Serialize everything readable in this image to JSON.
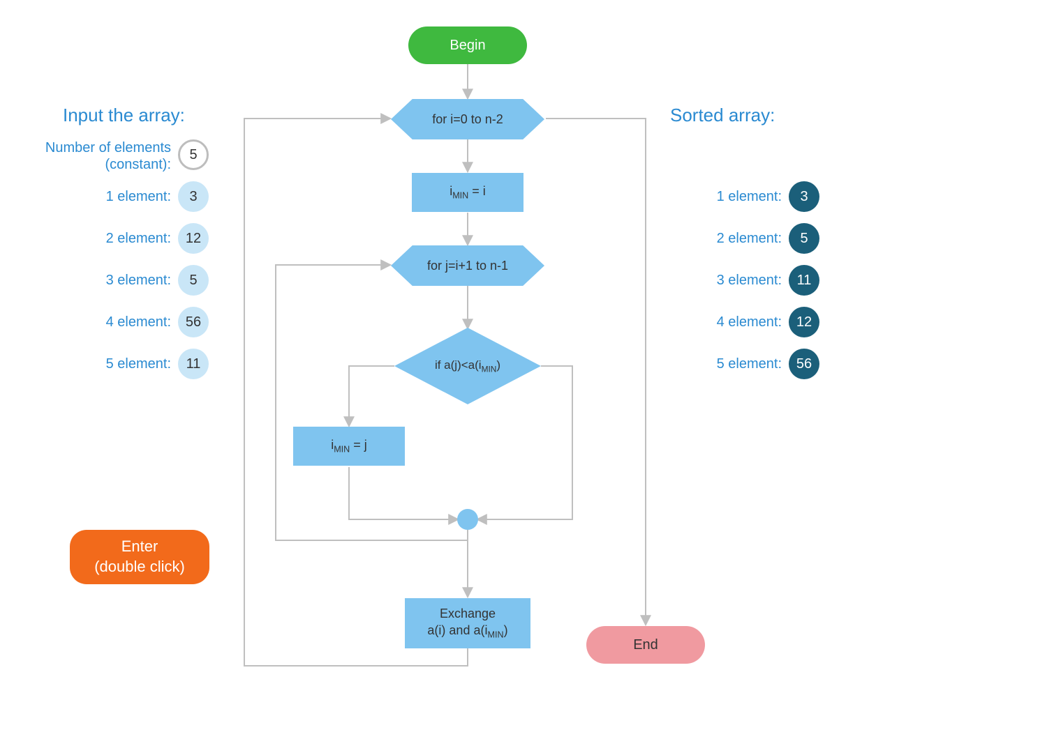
{
  "headings": {
    "input": "Input the array:",
    "sorted": "Sorted array:"
  },
  "input": {
    "count_label": "Number of elements\n(constant):",
    "count_value": "5",
    "items": [
      {
        "label": "1 element:",
        "value": "3"
      },
      {
        "label": "2 element:",
        "value": "12"
      },
      {
        "label": "3 element:",
        "value": "5"
      },
      {
        "label": "4 element:",
        "value": "56"
      },
      {
        "label": "5 element:",
        "value": "11"
      }
    ]
  },
  "sorted": {
    "items": [
      {
        "label": "1 element:",
        "value": "3"
      },
      {
        "label": "2 element:",
        "value": "5"
      },
      {
        "label": "3 element:",
        "value": "11"
      },
      {
        "label": "4 element:",
        "value": "12"
      },
      {
        "label": "5 element:",
        "value": "56"
      }
    ]
  },
  "enter": {
    "line1": "Enter",
    "line2": "(double click)"
  },
  "flow": {
    "begin": "Begin",
    "loop_i": "for i=0 to n-2",
    "set_min_i_pre": "i",
    "set_min_i_sub": "MIN",
    "set_min_i_post": " = i",
    "loop_j": "for j=i+1 to n-1",
    "cond_pre": "if a(j)<a(i",
    "cond_sub": "MIN",
    "cond_post": ")",
    "set_min_j_pre": "i",
    "set_min_j_sub": "MIN",
    "set_min_j_post": " = j",
    "exchange_l1": "Exchange",
    "exchange_l2_pre": "a(i) and a(i",
    "exchange_l2_sub": "MIN",
    "exchange_l2_post": ")",
    "end": "End"
  },
  "colors": {
    "blue_text": "#2a8ad1",
    "shape_blue": "#7fc4ef",
    "sorted_circle": "#1b5f7a",
    "begin": "#3fb93f",
    "end": "#f09aa0",
    "enter": "#f26a1b",
    "arrow": "#bfbfbf"
  }
}
